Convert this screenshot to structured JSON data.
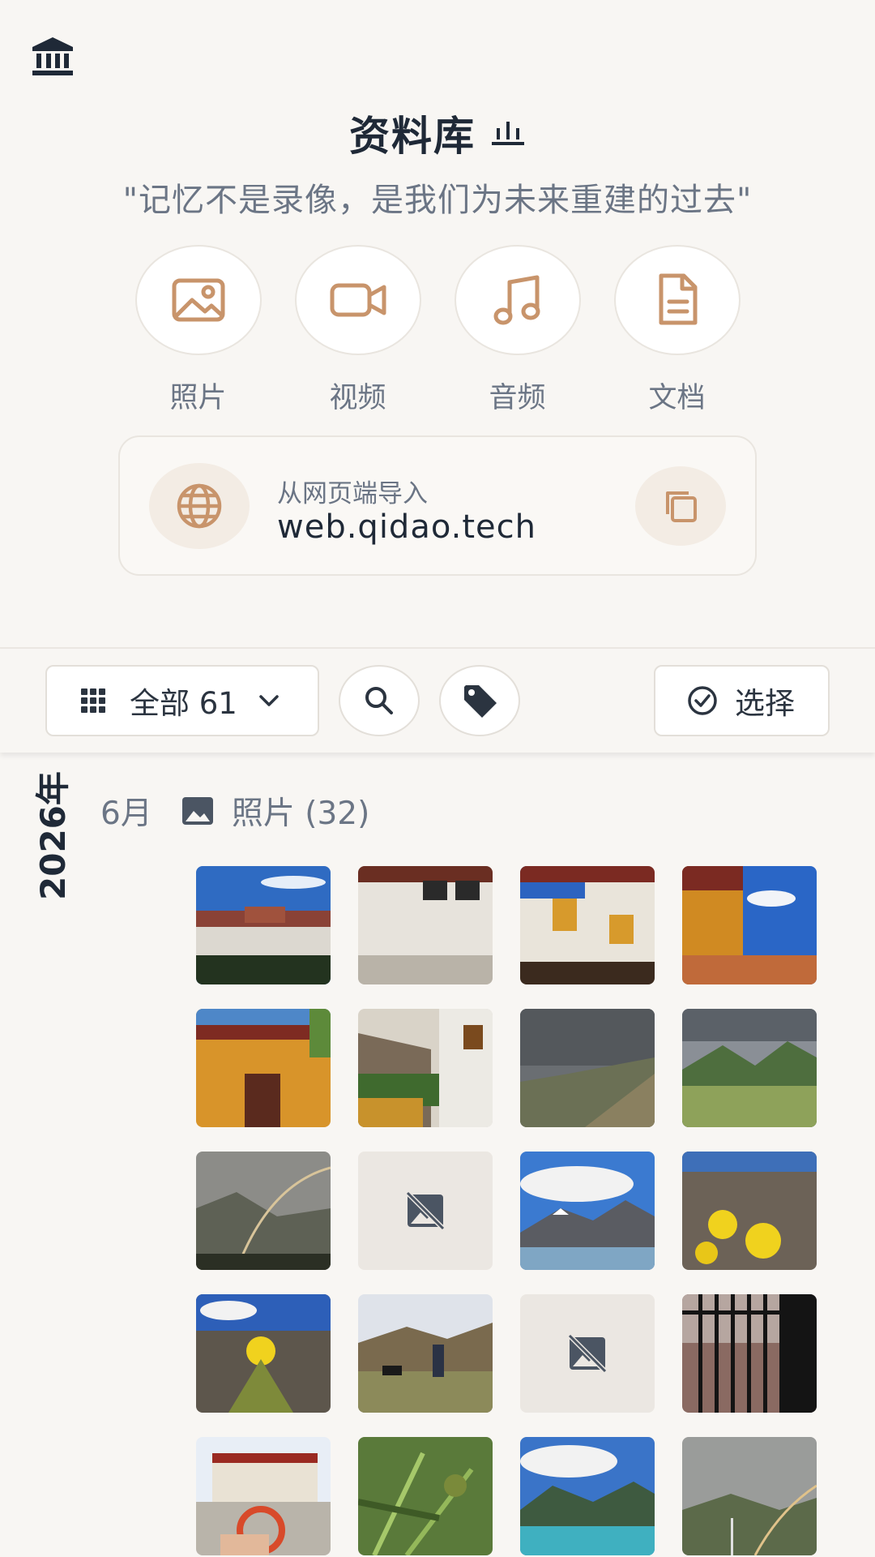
{
  "header": {
    "icon": "bank-icon",
    "title": "资料库",
    "title_mark": "chart-mark-icon",
    "quote": "\"记忆不是录像，是我们为未来重建的过去\""
  },
  "categories": [
    {
      "label": "照片",
      "icon": "image-icon"
    },
    {
      "label": "视频",
      "icon": "video-icon"
    },
    {
      "label": "音频",
      "icon": "music-icon"
    },
    {
      "label": "文档",
      "icon": "document-icon"
    }
  ],
  "web_import": {
    "label": "从网页端导入",
    "url": "web.qidao.tech",
    "icon": "globe-icon",
    "copy_icon": "copy-icon"
  },
  "toolbar": {
    "filter_label": "全部 61",
    "filter_icon": "grid-icon",
    "search_icon": "search-icon",
    "tag_icon": "tag-icon",
    "select_label": "选择",
    "select_icon": "check-circle-icon"
  },
  "timeline": {
    "year": "2026年",
    "month": "6月",
    "section_label": "照片 (32)"
  },
  "colors": {
    "background": "#f8f6f3",
    "accent": "#c8946b",
    "text_dark": "#1f2937",
    "text_muted": "#6b7585"
  }
}
